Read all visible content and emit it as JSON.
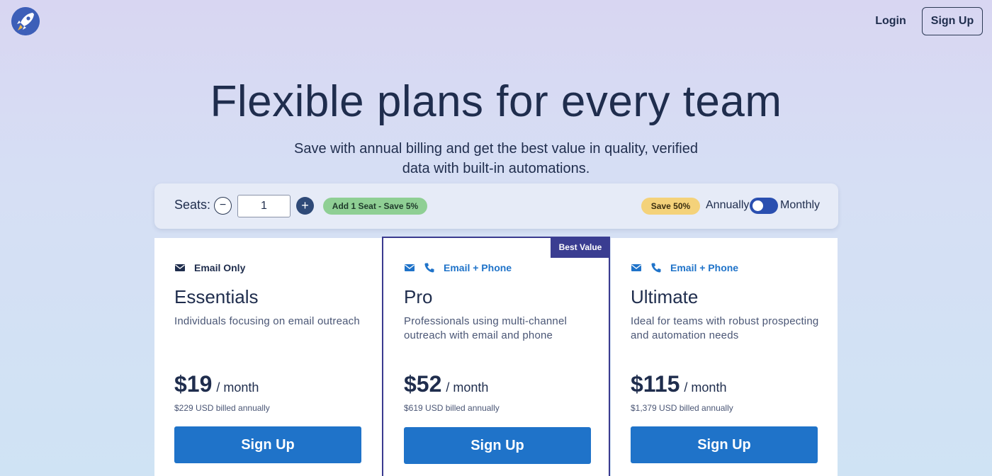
{
  "header": {
    "login_label": "Login",
    "signup_label": "Sign Up",
    "logo_icon": "rocket-icon"
  },
  "hero": {
    "title": "Flexible plans for every team",
    "subtitle": "Save with annual billing and get the best value in quality, verified data with built-in automations."
  },
  "seats": {
    "label": "Seats:",
    "value": "1",
    "offer": "Add 1 Seat - Save 5%",
    "save_badge": "Save 50%",
    "annually_label": "Annually",
    "monthly_label": "Monthly",
    "billing_toggle": "annually"
  },
  "plans": [
    {
      "channel_label": "Email Only",
      "channel_icons": [
        "mail-icon"
      ],
      "name": "Essentials",
      "description": "Individuals focusing on email outreach",
      "price": "$19",
      "per": "/ month",
      "annual": "$229 USD billed annually",
      "cta": "Sign Up"
    },
    {
      "badge": "Best Value",
      "channel_label": "Email + Phone",
      "channel_icons": [
        "mail-icon",
        "phone-icon"
      ],
      "name": "Pro",
      "description": "Professionals using multi-channel outreach with email and phone",
      "price": "$52",
      "per": "/ month",
      "annual": "$619 USD billed annually",
      "cta": "Sign Up"
    },
    {
      "channel_label": "Email + Phone",
      "channel_icons": [
        "mail-icon",
        "phone-icon"
      ],
      "name": "Ultimate",
      "description": "Ideal for teams with robust prospecting and automation needs",
      "price": "$115",
      "per": "/ month",
      "annual": "$1,379 USD billed annually",
      "cta": "Sign Up"
    }
  ],
  "colors": {
    "primary_button": "#1f73c9",
    "best_value_badge": "#3a3d91",
    "offer_badge": "#8fcf94",
    "save_badge": "#f4d27a",
    "toggle": "#2a4fb0"
  }
}
